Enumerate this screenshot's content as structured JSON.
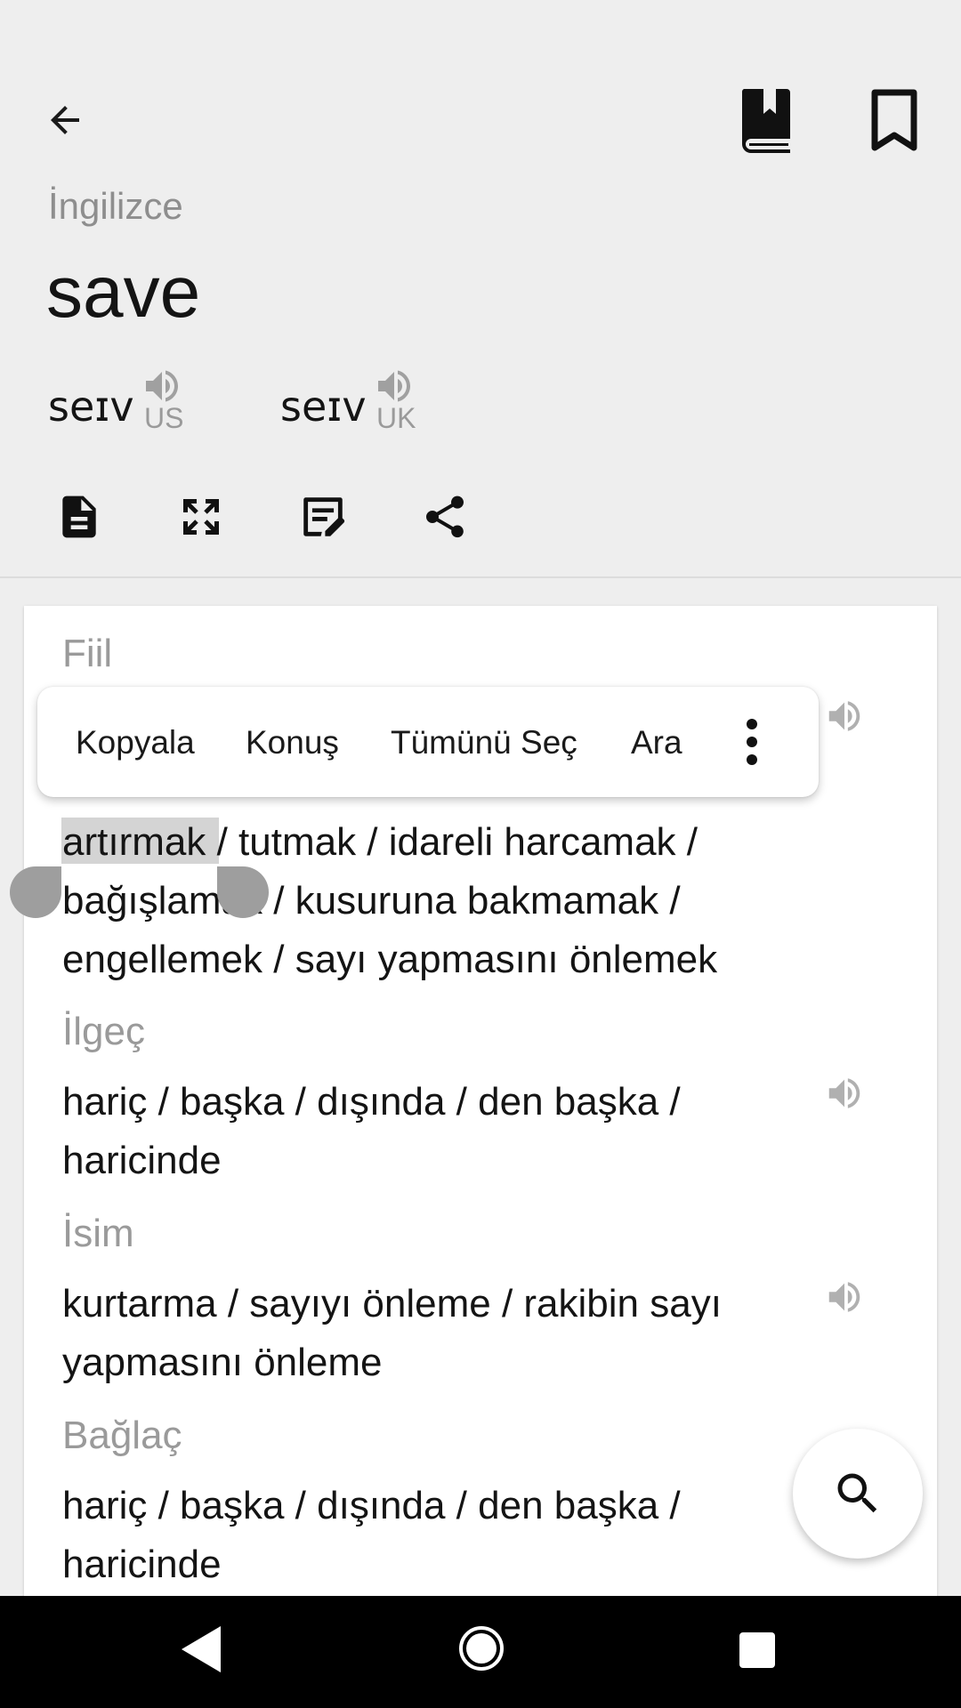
{
  "header": {
    "language": "İngilizce",
    "headword": "save",
    "pronunciations": [
      {
        "ipa": "seɪv",
        "region": "US"
      },
      {
        "ipa": "seɪv",
        "region": "UK"
      }
    ]
  },
  "icons": {
    "back": "arrow-back-icon",
    "dictionary": "book-icon",
    "bookmark": "bookmark-icon",
    "actions": [
      "document-icon",
      "fullscreen-icon",
      "edit-note-icon",
      "share-icon"
    ],
    "fab": "search-icon"
  },
  "context_menu": {
    "items": [
      "Kopyala",
      "Konuş",
      "Tümünü Seç",
      "Ara"
    ]
  },
  "entries": [
    {
      "pos": "Fiil",
      "lines": [
        "artırmak / tutmak / idareli harcamak /",
        "bağışlamak / kusuruna bakmamak /",
        "engellemek / sayı yapmasını önlemek"
      ]
    },
    {
      "pos": "İlgeç",
      "lines": [
        "hariç / başka / dışında / den başka /",
        "haricinde"
      ]
    },
    {
      "pos": "İsim",
      "lines": [
        "kurtarma / sayıyı önleme / rakibin sayı",
        "yapmasını önleme"
      ]
    },
    {
      "pos": "Bağlaç",
      "lines": [
        "hariç / başka / dışında / den başka /",
        "haricinde"
      ]
    }
  ]
}
